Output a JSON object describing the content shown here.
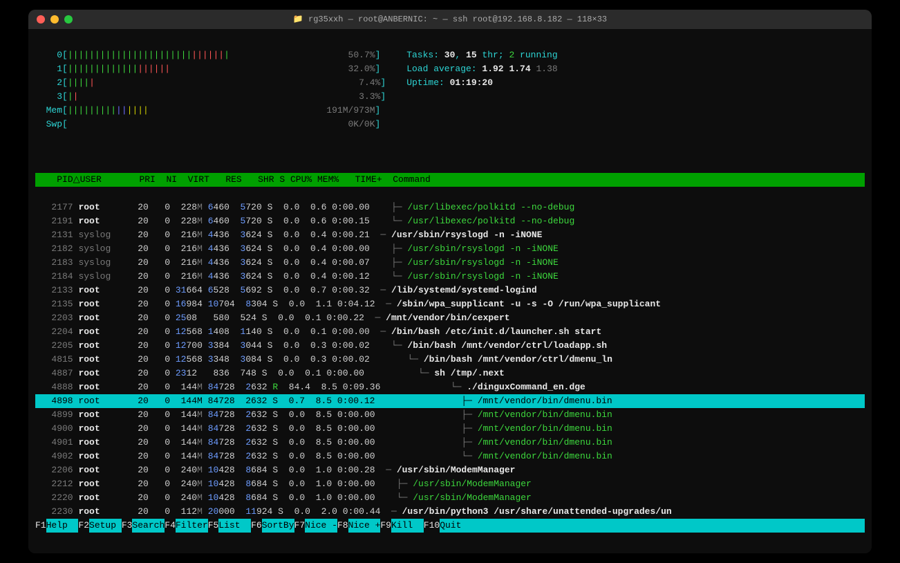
{
  "window": {
    "title": "rg35xxh — root@ANBERNIC: ~ — ssh root@192.168.8.182 — 118×33"
  },
  "cpu_meters": [
    {
      "id": "0",
      "bar_html": "<span class='bar-green'>|||||||||||||||||||||||</span><span class='bar-red'>||||||</span><span class='bar-green'>|</span>                      ",
      "pct": "50.7%"
    },
    {
      "id": "1",
      "bar_html": "<span class='bar-green'>|||||||||||||</span><span class='bar-red'>||||||</span>                                 ",
      "pct": "32.0%"
    },
    {
      "id": "2",
      "bar_html": "<span class='bar-green'>||||</span><span class='bar-red'>|</span>                                                ",
      "pct": "7.4%"
    },
    {
      "id": "3",
      "bar_html": "<span class='bar-green'>|</span><span class='bar-red'>|</span>                                                   ",
      "pct": "3.3%"
    }
  ],
  "mem": {
    "label": "Mem",
    "bar_html": "<span class='bar-green'>|||||||||</span><span class='bar-blue'>||</span><span class='bar-yellow'>||||</span>                                 ",
    "text": "191M/973M"
  },
  "swp": {
    "label": "Swp",
    "bar_html": "                                                    ",
    "text": "0K/0K"
  },
  "stats": {
    "tasks_label": "Tasks: ",
    "tasks": "30",
    "tasks_sep": ", ",
    "threads": "15",
    "thr_label": " thr; ",
    "running": "2",
    "running_label": " running",
    "load_label": "Load average: ",
    "load1": "1.92",
    "load5": "1.74",
    "load15": "1.38",
    "uptime_label": "Uptime: ",
    "uptime": "01:19:20"
  },
  "columns": {
    "pid": "PID",
    "sort": "△",
    "user": "USER",
    "pri": "PRI",
    "ni": "NI",
    "virt": "VIRT",
    "res": "RES",
    "shr": "SHR",
    "s": "S",
    "cpu": "CPU%",
    "mem": "MEM%",
    "time": "TIME+",
    "command": "Command"
  },
  "processes": [
    {
      "pid": "2177",
      "user": "root",
      "pri": "20",
      "ni": "0",
      "virt": "228M",
      "res": "6460",
      "shr": "5720",
      "s": "S",
      "cpu": "0.0",
      "mem": "0.6",
      "time": "0:00.00",
      "tree": "  ├─ ",
      "cmd": "/usr/libexec/polkitd --no-debug",
      "color": "green"
    },
    {
      "pid": "2191",
      "user": "root",
      "pri": "20",
      "ni": "0",
      "virt": "228M",
      "res": "6460",
      "shr": "5720",
      "s": "S",
      "cpu": "0.0",
      "mem": "0.6",
      "time": "0:00.15",
      "tree": "  └─ ",
      "cmd": "/usr/libexec/polkitd --no-debug",
      "color": "green"
    },
    {
      "pid": "2131",
      "user": "syslog",
      "pri": "20",
      "ni": "0",
      "virt": "216M",
      "res": "4436",
      "shr": "3624",
      "s": "S",
      "cpu": "0.0",
      "mem": "0.4",
      "time": "0:00.21",
      "tree": "─ ",
      "cmd": "/usr/sbin/rsyslogd -n -iNONE",
      "color": "white"
    },
    {
      "pid": "2182",
      "user": "syslog",
      "pri": "20",
      "ni": "0",
      "virt": "216M",
      "res": "4436",
      "shr": "3624",
      "s": "S",
      "cpu": "0.0",
      "mem": "0.4",
      "time": "0:00.00",
      "tree": "  ├─ ",
      "cmd": "/usr/sbin/rsyslogd -n -iNONE",
      "color": "green"
    },
    {
      "pid": "2183",
      "user": "syslog",
      "pri": "20",
      "ni": "0",
      "virt": "216M",
      "res": "4436",
      "shr": "3624",
      "s": "S",
      "cpu": "0.0",
      "mem": "0.4",
      "time": "0:00.07",
      "tree": "  ├─ ",
      "cmd": "/usr/sbin/rsyslogd -n -iNONE",
      "color": "green"
    },
    {
      "pid": "2184",
      "user": "syslog",
      "pri": "20",
      "ni": "0",
      "virt": "216M",
      "res": "4436",
      "shr": "3624",
      "s": "S",
      "cpu": "0.0",
      "mem": "0.4",
      "time": "0:00.12",
      "tree": "  └─ ",
      "cmd": "/usr/sbin/rsyslogd -n -iNONE",
      "color": "green"
    },
    {
      "pid": "2133",
      "user": "root",
      "pri": "20",
      "ni": "0",
      "virt": "31664",
      "res": "6528",
      "shr": "5692",
      "s": "S",
      "cpu": "0.0",
      "mem": "0.7",
      "time": "0:00.32",
      "tree": "─ ",
      "cmd": "/lib/systemd/systemd-logind",
      "color": "white"
    },
    {
      "pid": "2135",
      "user": "root",
      "pri": "20",
      "ni": "0",
      "virt": "16984",
      "res": "10704",
      "shr": "8304",
      "s": "S",
      "cpu": "0.0",
      "mem": "1.1",
      "time": "0:04.12",
      "tree": "─ ",
      "cmd": "/sbin/wpa_supplicant -u -s -O /run/wpa_supplicant",
      "color": "white"
    },
    {
      "pid": "2203",
      "user": "root",
      "pri": "20",
      "ni": "0",
      "virt": "2508",
      "res": "580",
      "shr": "524",
      "s": "S",
      "cpu": "0.0",
      "mem": "0.1",
      "time": "0:00.22",
      "tree": "─ ",
      "cmd": "/mnt/vendor/bin/cexpert",
      "color": "white"
    },
    {
      "pid": "2204",
      "user": "root",
      "pri": "20",
      "ni": "0",
      "virt": "12568",
      "res": "1408",
      "shr": "1140",
      "s": "S",
      "cpu": "0.0",
      "mem": "0.1",
      "time": "0:00.00",
      "tree": "─ ",
      "cmd": "/bin/bash /etc/init.d/launcher.sh start",
      "color": "white"
    },
    {
      "pid": "2205",
      "user": "root",
      "pri": "20",
      "ni": "0",
      "virt": "12700",
      "res": "3384",
      "shr": "3044",
      "s": "S",
      "cpu": "0.0",
      "mem": "0.3",
      "time": "0:00.02",
      "tree": "  └─ ",
      "cmd": "/bin/bash /mnt/vendor/ctrl/loadapp.sh",
      "color": "white"
    },
    {
      "pid": "4815",
      "user": "root",
      "pri": "20",
      "ni": "0",
      "virt": "12568",
      "res": "3348",
      "shr": "3084",
      "s": "S",
      "cpu": "0.0",
      "mem": "0.3",
      "time": "0:00.02",
      "tree": "     └─ ",
      "cmd": "/bin/bash /mnt/vendor/ctrl/dmenu_ln",
      "color": "white"
    },
    {
      "pid": "4887",
      "user": "root",
      "pri": "20",
      "ni": "0",
      "virt": "2312",
      "res": "836",
      "shr": "748",
      "s": "S",
      "cpu": "0.0",
      "mem": "0.1",
      "time": "0:00.00",
      "tree": "        └─ ",
      "cmd": "sh /tmp/.next",
      "color": "white"
    },
    {
      "pid": "4888",
      "user": "root",
      "pri": "20",
      "ni": "0",
      "virt": "144M",
      "res": "84728",
      "shr": "2632",
      "s": "R",
      "cpu": "84.4",
      "mem": "8.5",
      "time": "0:09.36",
      "tree": "           └─ ",
      "cmd": "./dinguxCommand_en.dge",
      "color": "white",
      "sR": true
    },
    {
      "pid": "4898",
      "user": "root",
      "pri": "20",
      "ni": "0",
      "virt": "144M",
      "res": "84728",
      "shr": "2632",
      "s": "S",
      "cpu": "0.7",
      "mem": "8.5",
      "time": "0:00.12",
      "tree": "              ├─ ",
      "cmd": "/mnt/vendor/bin/dmenu.bin",
      "color": "sel",
      "selected": true
    },
    {
      "pid": "4899",
      "user": "root",
      "pri": "20",
      "ni": "0",
      "virt": "144M",
      "res": "84728",
      "shr": "2632",
      "s": "S",
      "cpu": "0.0",
      "mem": "8.5",
      "time": "0:00.00",
      "tree": "              ├─ ",
      "cmd": "/mnt/vendor/bin/dmenu.bin",
      "color": "green"
    },
    {
      "pid": "4900",
      "user": "root",
      "pri": "20",
      "ni": "0",
      "virt": "144M",
      "res": "84728",
      "shr": "2632",
      "s": "S",
      "cpu": "0.0",
      "mem": "8.5",
      "time": "0:00.00",
      "tree": "              ├─ ",
      "cmd": "/mnt/vendor/bin/dmenu.bin",
      "color": "green"
    },
    {
      "pid": "4901",
      "user": "root",
      "pri": "20",
      "ni": "0",
      "virt": "144M",
      "res": "84728",
      "shr": "2632",
      "s": "S",
      "cpu": "0.0",
      "mem": "8.5",
      "time": "0:00.00",
      "tree": "              ├─ ",
      "cmd": "/mnt/vendor/bin/dmenu.bin",
      "color": "green"
    },
    {
      "pid": "4902",
      "user": "root",
      "pri": "20",
      "ni": "0",
      "virt": "144M",
      "res": "84728",
      "shr": "2632",
      "s": "S",
      "cpu": "0.0",
      "mem": "8.5",
      "time": "0:00.00",
      "tree": "              └─ ",
      "cmd": "/mnt/vendor/bin/dmenu.bin",
      "color": "green"
    },
    {
      "pid": "2206",
      "user": "root",
      "pri": "20",
      "ni": "0",
      "virt": "240M",
      "res": "10428",
      "shr": "8684",
      "s": "S",
      "cpu": "0.0",
      "mem": "1.0",
      "time": "0:00.28",
      "tree": "─ ",
      "cmd": "/usr/sbin/ModemManager",
      "color": "white"
    },
    {
      "pid": "2212",
      "user": "root",
      "pri": "20",
      "ni": "0",
      "virt": "240M",
      "res": "10428",
      "shr": "8684",
      "s": "S",
      "cpu": "0.0",
      "mem": "1.0",
      "time": "0:00.00",
      "tree": "  ├─ ",
      "cmd": "/usr/sbin/ModemManager",
      "color": "green"
    },
    {
      "pid": "2220",
      "user": "root",
      "pri": "20",
      "ni": "0",
      "virt": "240M",
      "res": "10428",
      "shr": "8684",
      "s": "S",
      "cpu": "0.0",
      "mem": "1.0",
      "time": "0:00.00",
      "tree": "  └─ ",
      "cmd": "/usr/sbin/ModemManager",
      "color": "green"
    },
    {
      "pid": "2230",
      "user": "root",
      "pri": "20",
      "ni": "0",
      "virt": "112M",
      "res": "20000",
      "shr": "11924",
      "s": "S",
      "cpu": "0.0",
      "mem": "2.0",
      "time": "0:00.44",
      "tree": "─ ",
      "cmd": "/usr/bin/python3 /usr/share/unattended-upgrades/un",
      "color": "white"
    }
  ],
  "footer": [
    {
      "key": "F1",
      "label": "Help  "
    },
    {
      "key": "F2",
      "label": "Setup "
    },
    {
      "key": "F3",
      "label": "Search"
    },
    {
      "key": "F4",
      "label": "Filter"
    },
    {
      "key": "F5",
      "label": "List  "
    },
    {
      "key": "F6",
      "label": "SortBy"
    },
    {
      "key": "F7",
      "label": "Nice -"
    },
    {
      "key": "F8",
      "label": "Nice +"
    },
    {
      "key": "F9",
      "label": "Kill  "
    },
    {
      "key": "F10",
      "label": "Quit  "
    }
  ]
}
